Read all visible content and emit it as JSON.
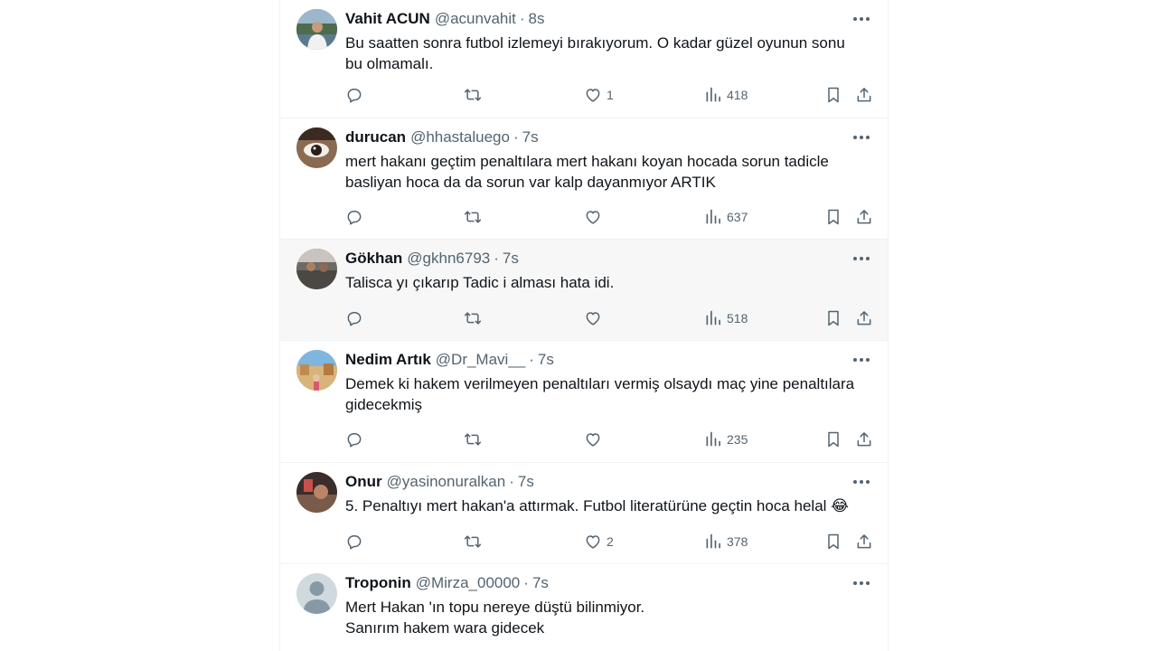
{
  "sep": "·",
  "tweets": [
    {
      "name": "Vahit ACUN",
      "handle": "@acunvahit",
      "time": "8s",
      "lines": [
        "Bu saatten sonra futbol izlemeyi bırakıyorum. O kadar güzel oyunun sonu",
        "bu olmamalı."
      ],
      "likes": "1",
      "views": "418",
      "replies": "",
      "retweets": ""
    },
    {
      "name": "durucan",
      "handle": "@hhastaluego",
      "time": "7s",
      "lines": [
        "mert hakanı geçtim penaltılara mert hakanı koyan hocada sorun tadicle",
        "basliyan hoca da da sorun var kalp dayanmıyor ARTIK"
      ],
      "likes": "",
      "views": "637",
      "replies": "",
      "retweets": ""
    },
    {
      "name": "Gökhan",
      "handle": "@gkhn6793",
      "time": "7s",
      "lines": [
        "Talisca yı çıkarıp Tadic i alması hata idi."
      ],
      "likes": "",
      "views": "518",
      "replies": "",
      "retweets": ""
    },
    {
      "name": "Nedim Artık",
      "handle": "@Dr_Mavi__",
      "time": "7s",
      "lines": [
        "Demek ki hakem verilmeyen penaltıları vermiş olsaydı maç yine penaltılara",
        "gidecekmiş"
      ],
      "likes": "",
      "views": "235",
      "replies": "",
      "retweets": ""
    },
    {
      "name": "Onur",
      "handle": "@yasinonuralkan",
      "time": "7s",
      "lines": [
        "5. Penaltıyı mert hakan'a attırmak. Futbol literatürüne geçtin hoca helal 😂"
      ],
      "likes": "2",
      "views": "378",
      "replies": "",
      "retweets": ""
    },
    {
      "name": "Troponin",
      "handle": "@Mirza_00000",
      "time": "7s",
      "lines": [
        "Mert Hakan 'ın topu nereye düştü bilinmiyor.",
        "Sanırım hakem wara gidecek"
      ],
      "likes": "",
      "views": "",
      "replies": "",
      "retweets": ""
    }
  ],
  "icons": [
    "more-icon",
    "reply-icon",
    "retweet-icon",
    "like-icon",
    "views-icon",
    "bookmark-icon",
    "share-icon"
  ],
  "colors": {
    "text": "#0f1419",
    "muted": "#536471",
    "border": "#eff3f4",
    "hover_bg": "#f7f7f7"
  }
}
